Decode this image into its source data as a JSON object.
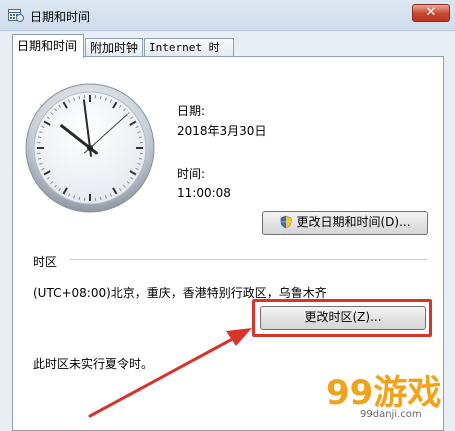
{
  "window": {
    "title": "日期和时间",
    "close_glyph": "✕"
  },
  "tabs": [
    {
      "label": "日期和时间",
      "active": true
    },
    {
      "label": "附加时钟",
      "active": false
    },
    {
      "label": "Internet 时间",
      "active": false
    }
  ],
  "clock": {
    "hour": 11,
    "minute": 0,
    "second": 8
  },
  "date": {
    "label": "日期:",
    "value": "2018年3月30日"
  },
  "time": {
    "label": "时间:",
    "value": "11:00:08"
  },
  "buttons": {
    "change_datetime": "更改日期和时间(D)...",
    "change_timezone": "更改时区(Z)..."
  },
  "timezone": {
    "section_title": "时区",
    "value": "(UTC+08:00)北京，重庆，香港特别行政区，乌鲁木齐",
    "dst_note": "此时区未实行夏令时。"
  },
  "watermark": {
    "main": "99游戏",
    "sub": "99danji.com"
  },
  "colors": {
    "highlight": "#d7352c",
    "watermark": "#f3a21b"
  }
}
